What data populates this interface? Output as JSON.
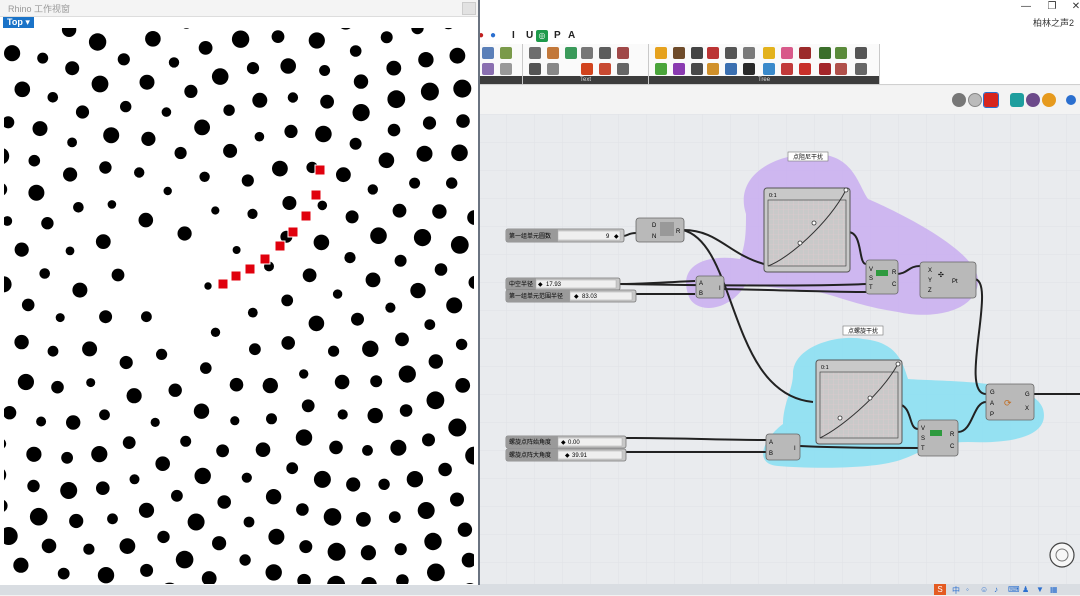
{
  "rhino": {
    "title": "Rhino 工作视窗",
    "viewport_label": "Top"
  },
  "gh": {
    "window": {
      "minimize_glyph": "—",
      "restore_glyph": "❐",
      "close_glyph": "✕",
      "document_name": "柏林之声2"
    },
    "menu_tabs": [
      "I",
      "U",
      "P",
      "A"
    ],
    "ribbon_groups": [
      {
        "label": "Text"
      },
      {
        "label": "Tree"
      }
    ],
    "groups": [
      {
        "label": "点阻尼干扰",
        "color": "#c9aef0"
      },
      {
        "label": "点螺旋干扰",
        "color": "#86dff2"
      }
    ],
    "sliders": [
      {
        "label": "第一组单元圆数",
        "value": "9"
      },
      {
        "label": "中空半径",
        "value": "17.93"
      },
      {
        "label": "第一组单元范围半径",
        "value": "83.03"
      },
      {
        "label": "螺旋点阵始角度",
        "value": "0.00"
      },
      {
        "label": "螺旋点阵大角度",
        "value": "39.91"
      }
    ],
    "components": [
      {
        "name": "divide",
        "in": [
          "D",
          "N"
        ],
        "out": [
          "R"
        ]
      },
      {
        "name": "bounds",
        "in": [
          "A",
          "B"
        ],
        "out": [
          "I"
        ]
      },
      {
        "name": "graph_top",
        "scale": "0:1"
      },
      {
        "name": "remap_top",
        "in": [
          "V",
          "S",
          "T"
        ],
        "out": [
          "R",
          "C"
        ]
      },
      {
        "name": "construct_pt",
        "in": [
          "X",
          "Y",
          "Z"
        ],
        "out": [
          "Pt"
        ]
      },
      {
        "name": "graph_bottom",
        "scale": "0:1"
      },
      {
        "name": "bounds_bottom",
        "in": [
          "A",
          "B"
        ],
        "out": [
          "I"
        ]
      },
      {
        "name": "remap_bottom",
        "in": [
          "V",
          "S",
          "T"
        ],
        "out": [
          "R",
          "C"
        ]
      },
      {
        "name": "polar",
        "in": [
          "G",
          "A",
          "P"
        ],
        "out": [
          "G",
          "X"
        ]
      }
    ]
  },
  "colors": {
    "accent": "#1a73c8",
    "group_purple": "#c9aef0",
    "group_cyan": "#86dff2",
    "highlight_red": "#e0000d"
  }
}
